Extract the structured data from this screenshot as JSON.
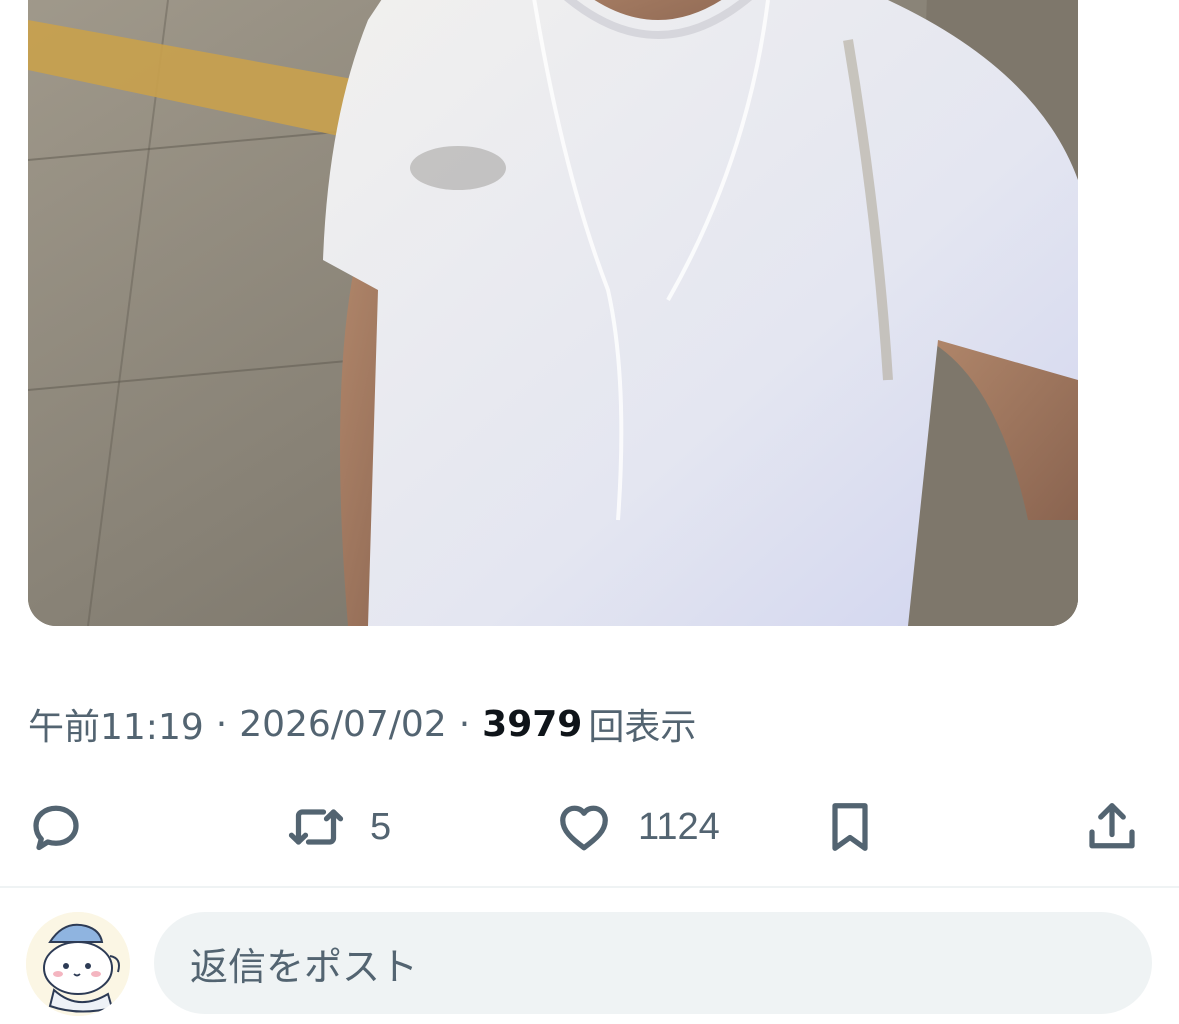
{
  "post": {
    "time": "午前11:19",
    "separator": "·",
    "date": "2026/07/02",
    "views_count": "3979",
    "views_label": "回表示"
  },
  "actions": {
    "reply_icon": "speech-bubble-icon",
    "repost_icon": "repost-arrows-icon",
    "repost_count": "5",
    "like_icon": "heart-icon",
    "like_count": "1124",
    "bookmark_icon": "bookmark-icon",
    "share_icon": "share-upload-icon"
  },
  "composer": {
    "placeholder": "返信をポスト",
    "avatar": "cartoon-character-avatar"
  },
  "colors": {
    "secondary_text": "#536471",
    "primary_text": "#0f1419",
    "input_background": "#eff3f4",
    "divider": "#eff3f4"
  }
}
